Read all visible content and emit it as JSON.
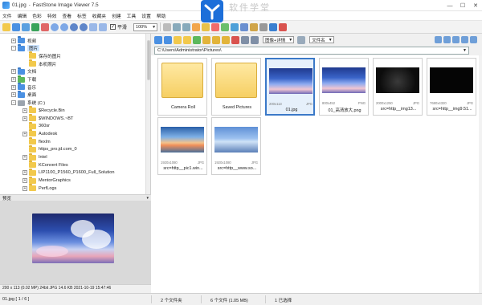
{
  "window": {
    "file_name": "01.jpg",
    "app_title": "FastStone Image Viewer 7.5",
    "watermark": "软件学堂",
    "controls": [
      "—",
      "☐",
      "✕"
    ]
  },
  "menu": [
    "文件",
    "编辑",
    "色彩",
    "特效",
    "查看",
    "标签",
    "收藏夹",
    "创建",
    "工具",
    "设置",
    "帮助"
  ],
  "toolbar": {
    "smooth_label": "平滑",
    "smooth_checked": true,
    "zoom_value": "100%"
  },
  "browser_toolbar": {
    "view_mode": "图像+详情",
    "sort_by": "文件名"
  },
  "address": {
    "path": "C:\\Users\\Administrator\\Pictures\\"
  },
  "tree": [
    {
      "label": "视频",
      "level": 1,
      "exp": "+",
      "icon": "blue"
    },
    {
      "label": "图片",
      "level": 1,
      "exp": "-",
      "icon": "blue",
      "selected": true
    },
    {
      "label": "保存的图片",
      "level": 2,
      "exp": "",
      "icon": "yellow"
    },
    {
      "label": "本机照片",
      "level": 2,
      "exp": "",
      "icon": "yellow"
    },
    {
      "label": "文档",
      "level": 1,
      "exp": "+",
      "icon": "blue"
    },
    {
      "label": "下载",
      "level": 1,
      "exp": "+",
      "icon": "green"
    },
    {
      "label": "音乐",
      "level": 1,
      "exp": "+",
      "icon": "blue"
    },
    {
      "label": "桌面",
      "level": 1,
      "exp": "+",
      "icon": "blue"
    },
    {
      "label": "系统 (C:)",
      "level": 1,
      "exp": "-",
      "icon": "drive"
    },
    {
      "label": "$Recycle.Bin",
      "level": 2,
      "exp": "+",
      "icon": "yellow"
    },
    {
      "label": "$WINDOWS.~BT",
      "level": 2,
      "exp": "+",
      "icon": "yellow"
    },
    {
      "label": "360sr",
      "level": 2,
      "exp": "",
      "icon": "yellow"
    },
    {
      "label": "Autodesk",
      "level": 2,
      "exp": "+",
      "icon": "yellow"
    },
    {
      "label": "flexlm",
      "level": 2,
      "exp": "",
      "icon": "yellow"
    },
    {
      "label": "https_pro.jd.com_0",
      "level": 2,
      "exp": "",
      "icon": "yellow"
    },
    {
      "label": "Intel",
      "level": 2,
      "exp": "+",
      "icon": "yellow"
    },
    {
      "label": "KConvert Files",
      "level": 2,
      "exp": "",
      "icon": "yellow"
    },
    {
      "label": "LIP1100_P1560_P1600_Full_Solution",
      "level": 2,
      "exp": "+",
      "icon": "yellow"
    },
    {
      "label": "MentorGraphics",
      "level": 2,
      "exp": "+",
      "icon": "yellow"
    },
    {
      "label": "PerfLogs",
      "level": 2,
      "exp": "+",
      "icon": "yellow"
    }
  ],
  "preview": {
    "header": "预览",
    "status": "200 x 113 (0.02 MP)  24bit  JPG  14.6 KB  2021-10-19 15:47:46"
  },
  "thumbnails": [
    {
      "name": "Camera Roll",
      "kind": "folder"
    },
    {
      "name": "Saved Pictures",
      "kind": "folder"
    },
    {
      "name": "01.jpg",
      "kind": "sky",
      "dims": "200x113",
      "ext": "JPG",
      "selected": true
    },
    {
      "name": "01_高清放大.png",
      "kind": "sky",
      "dims": "800x452",
      "ext": "PNG"
    },
    {
      "name": "src=http__img13...",
      "kind": "dark",
      "dims": "2000x1250",
      "ext": "JPG"
    },
    {
      "name": "src=http__img9.51...",
      "kind": "black",
      "dims": "7680x4320",
      "ext": "JPG"
    },
    {
      "name": "src=http__pic1.win...",
      "kind": "sunset",
      "dims": "1920x1080",
      "ext": "JPG"
    },
    {
      "name": "src=http__www.so...",
      "kind": "lake",
      "dims": "1920x1080",
      "ext": "JPG"
    }
  ],
  "status": {
    "page": "01.jpg [ 1 / 6 ]",
    "folders": "2 个文件夹",
    "files": "6 个文件 (1.05 MB)",
    "selected": "1 已选择"
  }
}
